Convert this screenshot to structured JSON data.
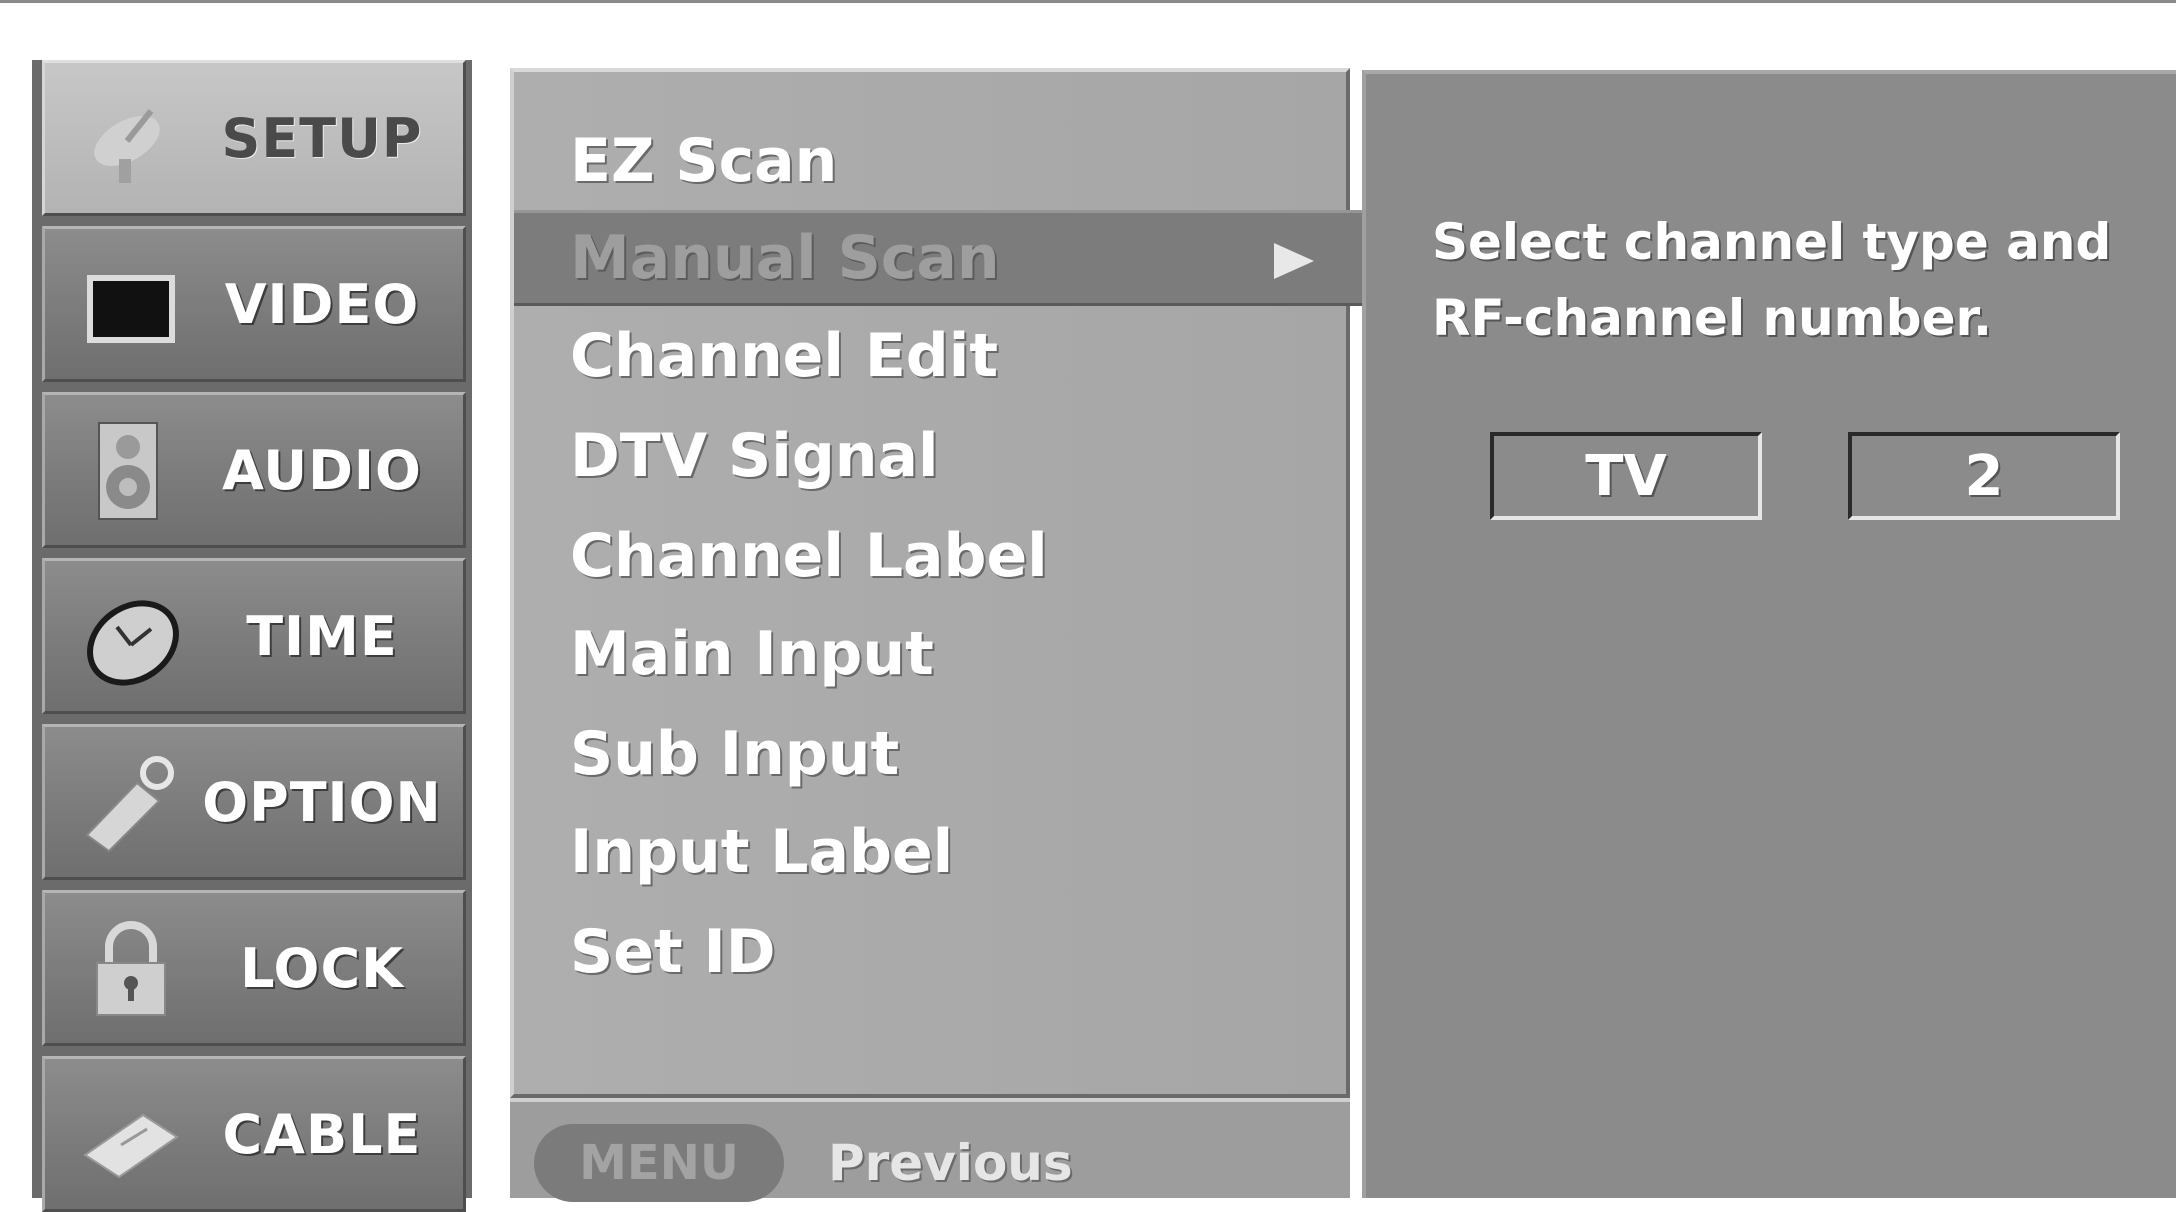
{
  "categories": [
    {
      "label": "SETUP",
      "icon": "satellite-dish-icon",
      "active": true
    },
    {
      "label": "VIDEO",
      "icon": "screen-icon",
      "active": false
    },
    {
      "label": "AUDIO",
      "icon": "speaker-icon",
      "active": false
    },
    {
      "label": "TIME",
      "icon": "clock-icon",
      "active": false
    },
    {
      "label": "OPTION",
      "icon": "tag-icon",
      "active": false
    },
    {
      "label": "LOCK",
      "icon": "lock-icon",
      "active": false
    },
    {
      "label": "CABLE",
      "icon": "cable-card-icon",
      "active": false
    }
  ],
  "menu": {
    "items": [
      "EZ Scan",
      "Manual Scan",
      "Channel Edit",
      "DTV Signal",
      "Channel Label",
      "Main Input",
      "Sub Input",
      "Input Label",
      "Set ID"
    ],
    "selected": "Manual Scan"
  },
  "footer": {
    "button_label": "MENU",
    "action_label": "Previous"
  },
  "info": {
    "line1": "Select channel type and",
    "line2": "RF-channel number.",
    "channel_type": "TV",
    "channel_number": "2"
  }
}
